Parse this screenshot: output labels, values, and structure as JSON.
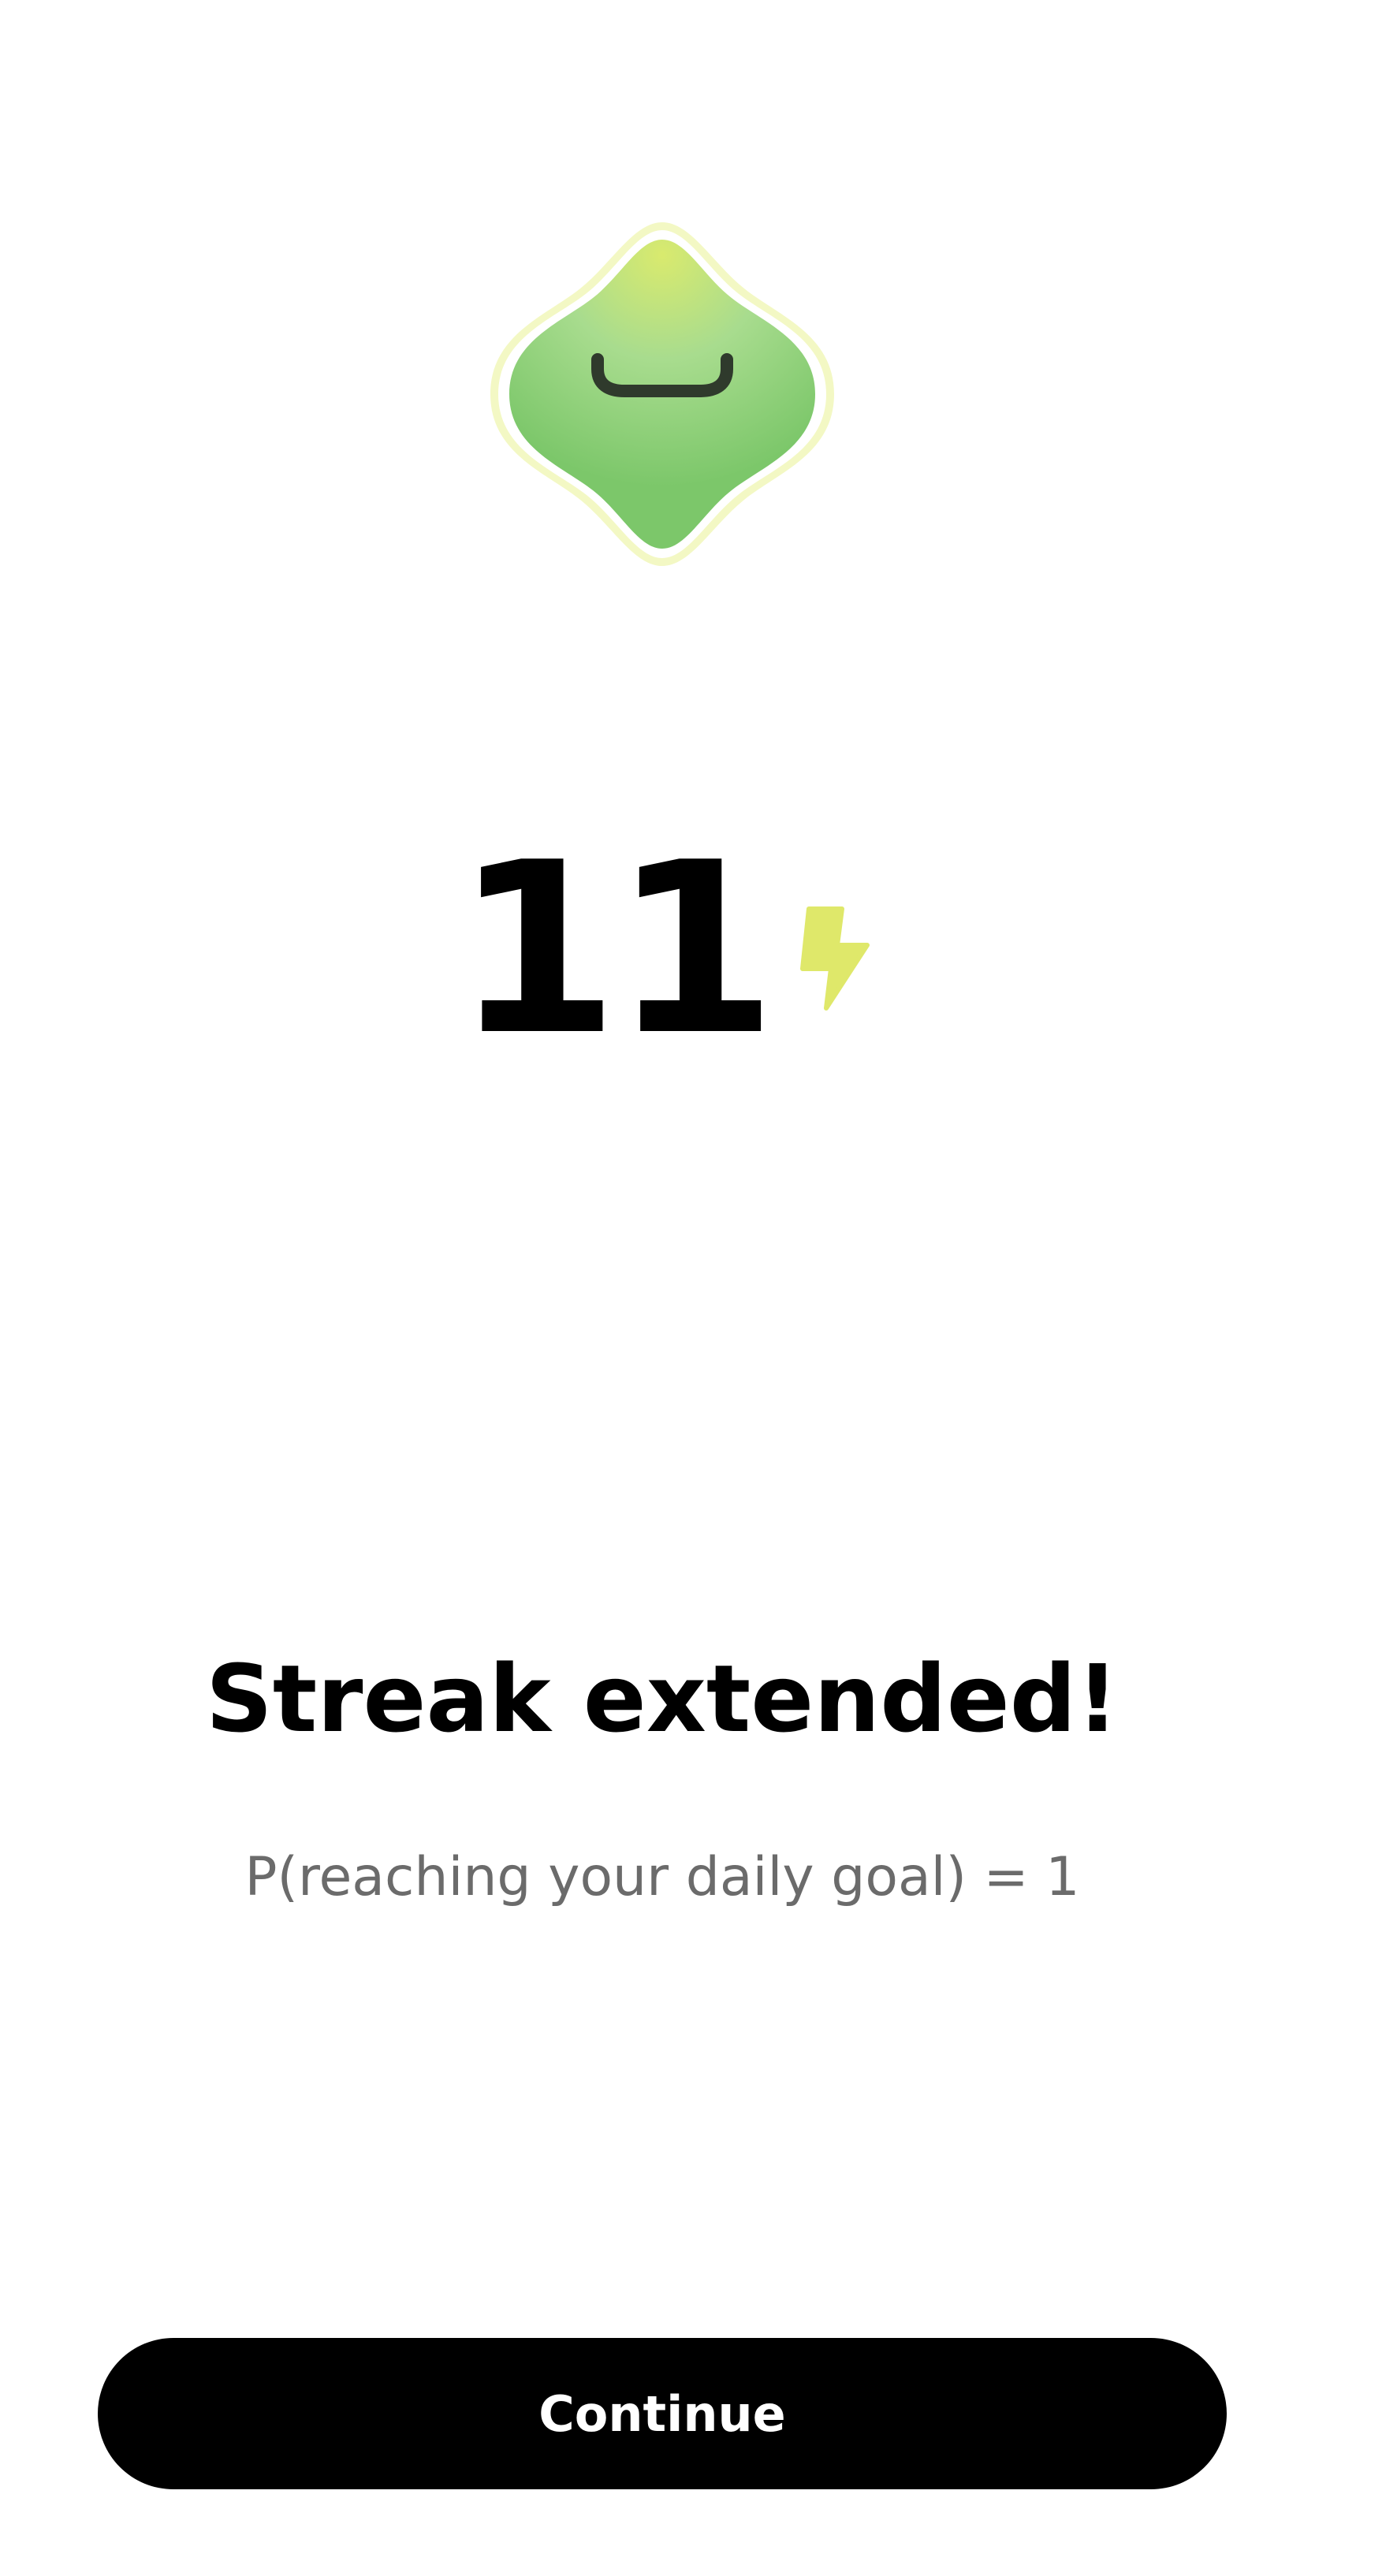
{
  "streak": {
    "count": "11",
    "icon": "lightning-bolt-icon",
    "accent_color": "#dfe86a"
  },
  "mascot": {
    "icon": "smiling-green-blob-mascot",
    "body_color": "#7dc66c",
    "glow_color": "#f3f8c4"
  },
  "message": {
    "title": "Streak extended!",
    "subtitle": "P(reaching your daily goal) = 1"
  },
  "actions": {
    "continue_label": "Continue"
  }
}
